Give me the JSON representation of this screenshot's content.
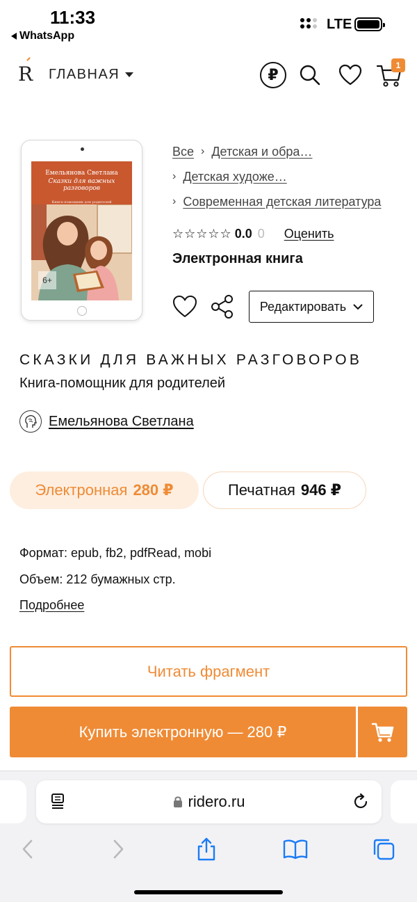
{
  "status_bar": {
    "time": "11:33",
    "back_app": "WhatsApp",
    "network": "LTE"
  },
  "header": {
    "logo": "R",
    "nav_label": "ГЛАВНАЯ",
    "currency_symbol": "₽",
    "cart_count": "1",
    "icons": [
      "ruble-icon",
      "search-icon",
      "heart-icon",
      "cart-icon"
    ]
  },
  "cover": {
    "author": "Емельянова Светлана",
    "title": "Сказки для важных разговоров",
    "subtitle": "Книга-помощник для родителей",
    "age": "6+"
  },
  "breadcrumbs": {
    "items": [
      "Все",
      "Детская и обра…",
      "Детская художе…",
      "Современная детская литература"
    ]
  },
  "rating": {
    "stars": "☆☆☆☆☆",
    "value": "0.0",
    "count": "0",
    "rate_label": "Оценить"
  },
  "book": {
    "type": "Электронная книга",
    "title": "СКАЗКИ ДЛЯ ВАЖНЫХ РАЗГОВОРОВ",
    "subtitle": "Книга-помощник для родителей",
    "author": "Емельянова Светлана",
    "edit_label": "Редактировать"
  },
  "formats": {
    "ebook_label": "Электронная",
    "ebook_price": "280 ₽",
    "print_label": "Печатная",
    "print_price": "946 ₽",
    "selected": "ebook"
  },
  "info": {
    "format": "Формат: epub, fb2, pdfRead, mobi",
    "volume": "Объем: 212 бумажных стр.",
    "more": "Подробнее"
  },
  "buttons": {
    "read_fragment": "Читать фрагмент",
    "buy": "Купить электронную — 280 ₽"
  },
  "browser": {
    "url": "ridero.ru"
  },
  "colors": {
    "accent": "#ef8b35",
    "accent_light": "#fdeee0",
    "text": "#111111"
  }
}
